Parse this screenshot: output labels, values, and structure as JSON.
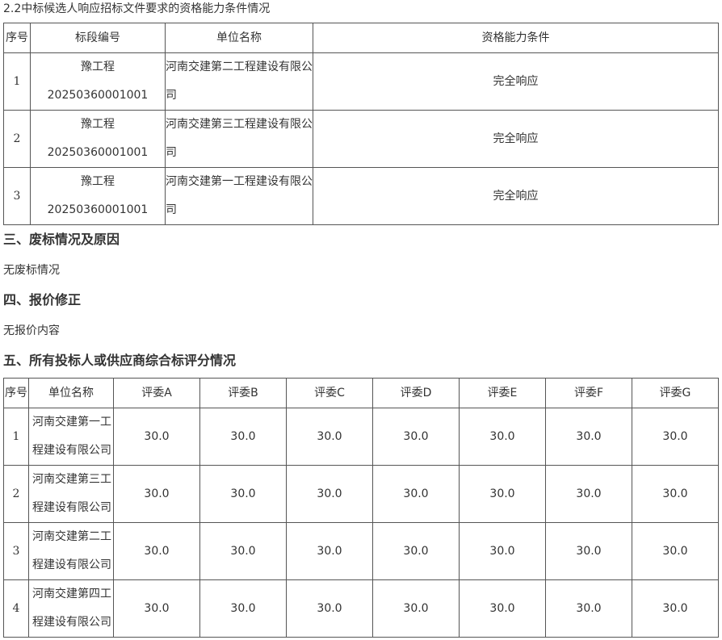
{
  "caption": "2.2中标候选人响应招标文件要求的资格能力条件情况",
  "table1": {
    "headers": [
      "序号",
      "标段编号",
      "单位名称",
      "资格能力条件"
    ],
    "rows": [
      {
        "no": "1",
        "code": "豫工程20250360001001",
        "company": "河南交建第二工程建设有限公司",
        "qualification": "完全响应"
      },
      {
        "no": "2",
        "code": "豫工程20250360001001",
        "company": "河南交建第三工程建设有限公司",
        "qualification": "完全响应"
      },
      {
        "no": "3",
        "code": "豫工程20250360001001",
        "company": "河南交建第一工程建设有限公司",
        "qualification": "完全响应"
      }
    ]
  },
  "section3": {
    "title": "三、废标情况及原因",
    "text": "无废标情况"
  },
  "section4": {
    "title": "四、报价修正",
    "text": "无报价内容"
  },
  "section5": {
    "title": "五、所有投标人或供应商综合标评分情况"
  },
  "table2": {
    "headers": [
      "序号",
      "单位名称",
      "评委A",
      "评委B",
      "评委C",
      "评委D",
      "评委E",
      "评委F",
      "评委G"
    ],
    "rows": [
      {
        "no": "1",
        "company": "河南交建第一工程建设有限公司",
        "scores": [
          "30.0",
          "30.0",
          "30.0",
          "30.0",
          "30.0",
          "30.0",
          "30.0"
        ]
      },
      {
        "no": "2",
        "company": "河南交建第三工程建设有限公司",
        "scores": [
          "30.0",
          "30.0",
          "30.0",
          "30.0",
          "30.0",
          "30.0",
          "30.0"
        ]
      },
      {
        "no": "3",
        "company": "河南交建第二工程建设有限公司",
        "scores": [
          "30.0",
          "30.0",
          "30.0",
          "30.0",
          "30.0",
          "30.0",
          "30.0"
        ]
      },
      {
        "no": "4",
        "company": "河南交建第四工程建设有限公司",
        "scores": [
          "30.0",
          "30.0",
          "30.0",
          "30.0",
          "30.0",
          "30.0",
          "30.0"
        ]
      }
    ]
  }
}
